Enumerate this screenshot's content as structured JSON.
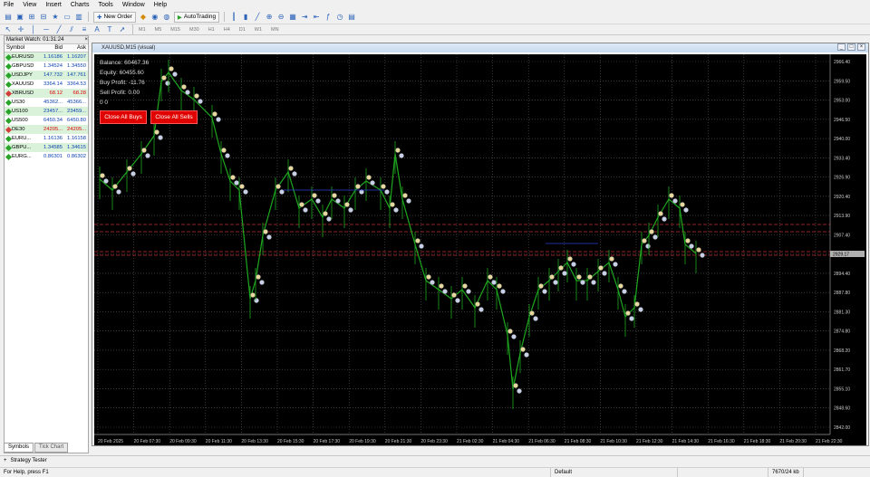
{
  "menu": [
    "File",
    "View",
    "Insert",
    "Charts",
    "Tools",
    "Window",
    "Help"
  ],
  "toolbar": {
    "new_order": "New Order",
    "auto_trading": "AutoTrading"
  },
  "timeframes": [
    "M1",
    "M5",
    "M15",
    "M30",
    "H1",
    "H4",
    "D1",
    "W1",
    "MN"
  ],
  "market_watch": {
    "title": "Market Watch: 01:31:24",
    "headers": {
      "symbol": "Symbol",
      "bid": "Bid",
      "ask": "Ask"
    },
    "rows": [
      {
        "symbol": "EURUSD",
        "bid": "1.16186",
        "ask": "1.16207",
        "color": "#28a428",
        "bg": "#d9f2d9"
      },
      {
        "symbol": "GBPUSD",
        "bid": "1.34524",
        "ask": "1.34550",
        "color": "#28a428",
        "bg": "#ffffff"
      },
      {
        "symbol": "USDJPY",
        "bid": "147.732",
        "ask": "147.761",
        "color": "#28a428",
        "bg": "#d9f2d9"
      },
      {
        "symbol": "XAUUSD",
        "bid": "3364.14",
        "ask": "3364.53",
        "color": "#28a428",
        "bg": "#ffffff"
      },
      {
        "symbol": "XBRUSD",
        "bid": "68.12",
        "ask": "68.28",
        "color": "#d43b3b",
        "bg": "#d9f2d9"
      },
      {
        "symbol": "US30",
        "bid": "45362...",
        "ask": "45366...",
        "color": "#28a428",
        "bg": "#ffffff"
      },
      {
        "symbol": "US100",
        "bid": "23457...",
        "ask": "23459...",
        "color": "#28a428",
        "bg": "#d9f2d9"
      },
      {
        "symbol": "US500",
        "bid": "6450.34",
        "ask": "6450.80",
        "color": "#28a428",
        "bg": "#ffffff"
      },
      {
        "symbol": "DE30",
        "bid": "24205...",
        "ask": "24205...",
        "color": "#d43b3b",
        "bg": "#d9f2d9"
      },
      {
        "symbol": "EURU...",
        "bid": "1.16136",
        "ask": "1.16158",
        "color": "#28a428",
        "bg": "#ffffff"
      },
      {
        "symbol": "GBPU...",
        "bid": "1.34585",
        "ask": "1.34615",
        "color": "#28a428",
        "bg": "#d9f2d9"
      },
      {
        "symbol": "EURG...",
        "bid": "0.86301",
        "ask": "0.86302",
        "color": "#28a428",
        "bg": "#ffffff"
      }
    ],
    "tabs": [
      "Symbols",
      "Tick Chart"
    ]
  },
  "chart": {
    "title": "XAUUSD,M15 (visual)",
    "info": {
      "balance": "Balance: 60467.36",
      "equity": "Equity: 60455.60",
      "buy_profit": "Buy Profit: -11.76",
      "sell_profit": "Sell Profit: 0.00",
      "extra": "0      0"
    },
    "buttons": {
      "close_buys": "Close All Buys",
      "close_sells": "Close All Sells"
    },
    "price_axis": [
      "2966.40",
      "2959.50",
      "2953.00",
      "2946.50",
      "2940.00",
      "2933.40",
      "2926.90",
      "2920.40",
      "2913.90",
      "2907.40",
      "2900.90",
      "2894.40",
      "2887.80",
      "2881.30",
      "2874.80",
      "2868.20",
      "2861.70",
      "2855.10",
      "2848.60",
      "2842.00"
    ],
    "current_price": "2929.17",
    "time_axis": [
      "20 Feb 2025",
      "20 Feb 07:30",
      "20 Feb 09:30",
      "20 Feb 11:30",
      "20 Feb 13:30",
      "20 Feb 15:30",
      "20 Feb 17:30",
      "20 Feb 19:30",
      "20 Feb 21:30",
      "20 Feb 23:30",
      "21 Feb 02:30",
      "21 Feb 04:30",
      "21 Feb 06:30",
      "21 Feb 08:30",
      "21 Feb 10:30",
      "21 Feb 12:30",
      "21 Feb 14:30",
      "21 Feb 16:30",
      "21 Feb 18:30",
      "21 Feb 20:30",
      "21 Feb 22:30"
    ]
  },
  "bottom": {
    "strategy_tester": "Strategy Tester",
    "help_hint": "For Help, press F1",
    "profile": "Default",
    "traffic": "7670/24 kb"
  }
}
